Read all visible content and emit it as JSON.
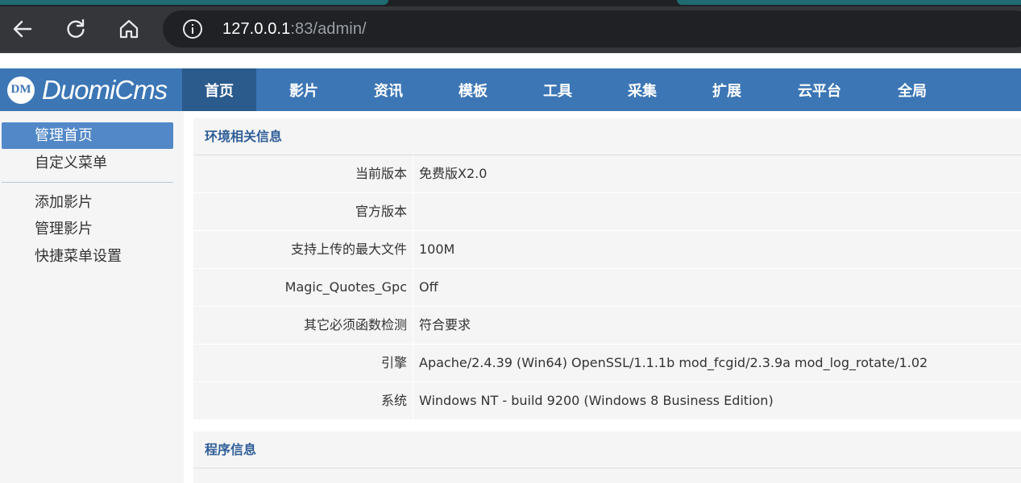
{
  "browser": {
    "url_host": "127.0.0.1",
    "url_rest": ":83/admin/",
    "back_icon": "arrow-left",
    "reload_icon": "reload",
    "home_icon": "home",
    "info_icon": "info-circle"
  },
  "site": {
    "logo_mark": "DM",
    "logo_text": "DuomiCms"
  },
  "topnav": {
    "items": [
      {
        "label": "首页",
        "active": true
      },
      {
        "label": "影片"
      },
      {
        "label": "资讯"
      },
      {
        "label": "模板"
      },
      {
        "label": "工具"
      },
      {
        "label": "采集"
      },
      {
        "label": "扩展"
      },
      {
        "label": "云平台"
      },
      {
        "label": "全局"
      }
    ]
  },
  "sidebar": {
    "items": [
      {
        "label": "管理首页",
        "active": true
      },
      {
        "label": "自定义菜单"
      },
      {
        "label": "添加影片"
      },
      {
        "label": "管理影片"
      },
      {
        "label": "快捷菜单设置"
      }
    ]
  },
  "env_panel": {
    "title": "环境相关信息",
    "rows": [
      {
        "label": "当前版本",
        "value": "免费版X2.0"
      },
      {
        "label": "官方版本",
        "value": ""
      },
      {
        "label": "支持上传的最大文件",
        "value": "100M"
      },
      {
        "label": "Magic_Quotes_Gpc",
        "value": "Off"
      },
      {
        "label": "其它必须函数检测",
        "value": "符合要求"
      },
      {
        "label": "引擎",
        "value": "Apache/2.4.39 (Win64) OpenSSL/1.1.1b mod_fcgid/2.3.9a mod_log_rotate/1.02"
      },
      {
        "label": "系统",
        "value": "Windows NT - build 9200 (Windows 8 Business Edition)"
      }
    ]
  },
  "program_panel": {
    "title": "程序信息"
  },
  "colors": {
    "nav_bg": "#3c76b5",
    "nav_active": "#2b5a8c",
    "sidebar_active": "#5288c8",
    "panel_title": "#2f5e98"
  }
}
